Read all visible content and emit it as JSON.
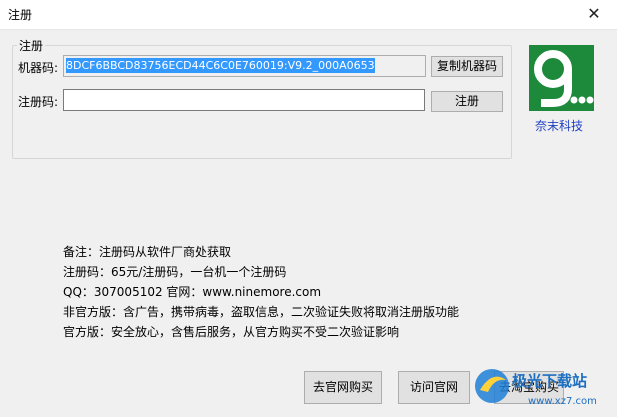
{
  "window": {
    "title": "注册",
    "close_glyph": "✕"
  },
  "group": {
    "title": "注册"
  },
  "machine_code": {
    "label": "机器码:",
    "value": "8DCF6BBCD83756ECD44C6C0E760019:V9.2_000A0653",
    "copy_button": "复制机器码"
  },
  "reg_code": {
    "label": "注册码:",
    "value": "",
    "register_button": "注册"
  },
  "brand": {
    "logo_text": "9...",
    "name": "奈末科技"
  },
  "notes": [
    "备注：注册码从软件厂商处获取",
    "注册码：65元/注册码，一台机一个注册码",
    "QQ：307005102 官网：www.ninemore.com",
    "非官方版：含广告，携带病毒，盗取信息，二次验证失败将取消注册版功能",
    "官方版：安全放心，含售后服务，从官方购买不受二次验证影响"
  ],
  "buttons": {
    "buy_official": "去官网购买",
    "visit_site": "访问官网",
    "buy_taobao": "去淘宝购买"
  },
  "watermark": {
    "text": "极光下载站",
    "url": "www.xz7.com"
  },
  "colors": {
    "selection": "#3399ff",
    "logo_green": "#1c8a3a",
    "brand_blue": "#1f3fbf"
  }
}
